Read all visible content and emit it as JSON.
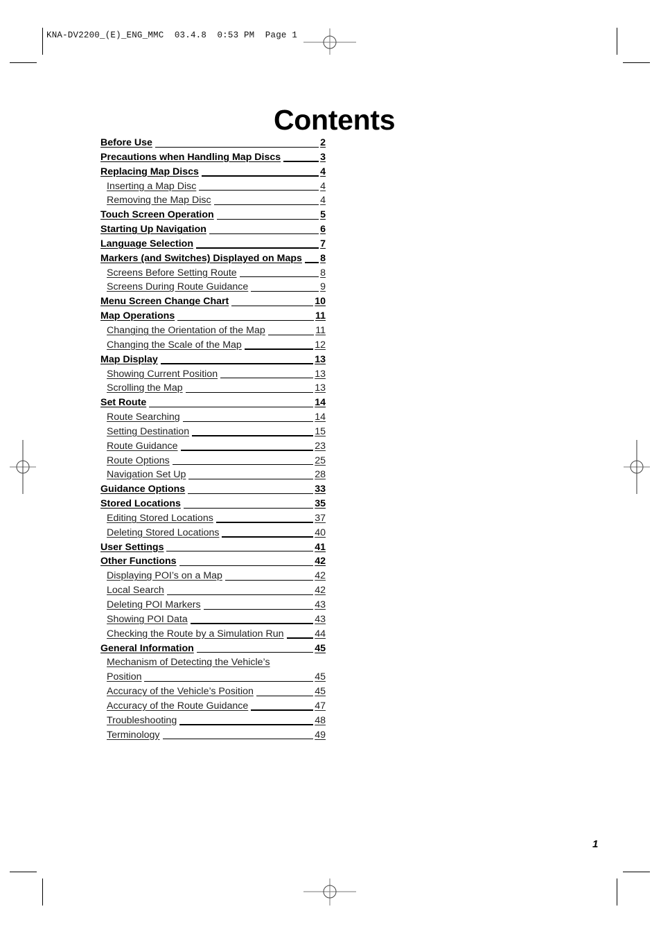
{
  "slug": {
    "file": "KNA-DV2200_(E)_ENG_MMC",
    "date": "03.4.8",
    "time": "0:53 PM",
    "page_label": "Page",
    "page_value": "1"
  },
  "title": "Contents",
  "toc": [
    {
      "level": 1,
      "label": "Before Use",
      "page": "2"
    },
    {
      "level": 1,
      "label": "Precautions when Handling Map Discs",
      "page": "3"
    },
    {
      "level": 1,
      "label": "Replacing Map Discs",
      "page": "4"
    },
    {
      "level": 2,
      "label": "Inserting a Map Disc",
      "page": "4"
    },
    {
      "level": 2,
      "label": "Removing the Map Disc",
      "page": "4"
    },
    {
      "level": 1,
      "label": "Touch Screen Operation",
      "page": "5"
    },
    {
      "level": 1,
      "label": "Starting Up Navigation",
      "page": "6"
    },
    {
      "level": 1,
      "label": "Language Selection",
      "page": "7"
    },
    {
      "level": 1,
      "label": "Markers (and Switches) Displayed on Maps",
      "page": "8"
    },
    {
      "level": 2,
      "label": "Screens Before Setting Route",
      "page": "8"
    },
    {
      "level": 2,
      "label": "Screens During Route Guidance",
      "page": "9"
    },
    {
      "level": 1,
      "label": "Menu Screen Change Chart",
      "page": "10"
    },
    {
      "level": 1,
      "label": "Map Operations",
      "page": "11"
    },
    {
      "level": 2,
      "label": "Changing the Orientation of the Map",
      "page": "11"
    },
    {
      "level": 2,
      "label": "Changing the Scale of the Map",
      "page": "12"
    },
    {
      "level": 1,
      "label": "Map Display",
      "page": "13"
    },
    {
      "level": 2,
      "label": "Showing Current Position",
      "page": "13"
    },
    {
      "level": 2,
      "label": "Scrolling the Map",
      "page": "13"
    },
    {
      "level": 1,
      "label": "Set Route",
      "page": "14"
    },
    {
      "level": 2,
      "label": "Route Searching",
      "page": "14"
    },
    {
      "level": 2,
      "label": "Setting Destination",
      "page": "15"
    },
    {
      "level": 2,
      "label": "Route Guidance",
      "page": "23"
    },
    {
      "level": 2,
      "label": "Route Options",
      "page": "25"
    },
    {
      "level": 2,
      "label": "Navigation Set Up",
      "page": "28"
    },
    {
      "level": 1,
      "label": "Guidance Options",
      "page": "33"
    },
    {
      "level": 1,
      "label": "Stored Locations",
      "page": "35"
    },
    {
      "level": 2,
      "label": "Editing Stored Locations",
      "page": "37"
    },
    {
      "level": 2,
      "label": "Deleting Stored Locations",
      "page": "40"
    },
    {
      "level": 1,
      "label": "User Settings",
      "page": "41"
    },
    {
      "level": 1,
      "label": "Other Functions",
      "page": "42"
    },
    {
      "level": 2,
      "label": "Displaying POI’s on a Map",
      "page": "42"
    },
    {
      "level": 2,
      "label": "Local Search",
      "page": "42"
    },
    {
      "level": 2,
      "label": "Deleting POI Markers",
      "page": "43"
    },
    {
      "level": 2,
      "label": "Showing POI Data",
      "page": "43"
    },
    {
      "level": 2,
      "label": "Checking the Route by a Simulation Run",
      "page": "44"
    },
    {
      "level": 1,
      "label": "General Information",
      "page": "45"
    },
    {
      "level": 2,
      "label": "Mechanism of Detecting the Vehicle’s",
      "page": "",
      "wrap": true
    },
    {
      "level": 2,
      "label": "Position",
      "page": "45"
    },
    {
      "level": 2,
      "label": "Accuracy of the Vehicle’s Position",
      "page": "45"
    },
    {
      "level": 2,
      "label": "Accuracy of the Route Guidance",
      "page": "47"
    },
    {
      "level": 2,
      "label": "Troubleshooting",
      "page": "48"
    },
    {
      "level": 2,
      "label": "Terminology",
      "page": "49"
    }
  ],
  "page_number": "1"
}
